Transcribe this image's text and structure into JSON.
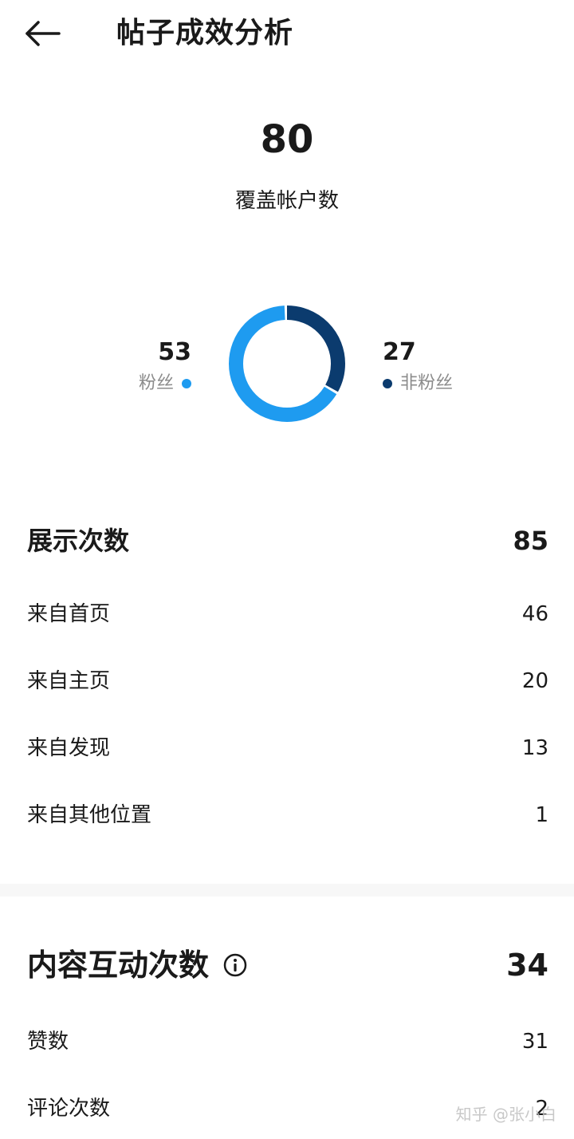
{
  "header": {
    "title": "帖子成效分析"
  },
  "reach": {
    "value": "80",
    "label": "覆盖帐户数",
    "followers": {
      "value": "53",
      "label": "粉丝",
      "color": "#1e9bf0"
    },
    "non_followers": {
      "value": "27",
      "label": "非粉丝",
      "color": "#0b3b6e"
    }
  },
  "impressions": {
    "title": "展示次数",
    "total": "85",
    "rows": [
      {
        "label": "来自首页",
        "value": "46"
      },
      {
        "label": "来自主页",
        "value": "20"
      },
      {
        "label": "来自发现",
        "value": "13"
      },
      {
        "label": "来自其他位置",
        "value": "1"
      }
    ]
  },
  "interactions": {
    "title": "内容互动次数",
    "info_icon": "info-icon",
    "total": "34",
    "rows": [
      {
        "label": "赞数",
        "value": "31"
      },
      {
        "label": "评论次数",
        "value": "2"
      }
    ]
  },
  "watermark": "知乎 @张小白"
}
